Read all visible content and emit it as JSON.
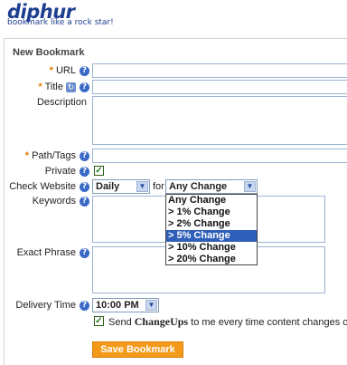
{
  "app": {
    "logo": "diphur",
    "tagline": "bookmark like a rock star!"
  },
  "form": {
    "heading": "New Bookmark",
    "required_mark": "*",
    "help_glyph": "?",
    "fields": {
      "url": "URL",
      "title": "Title",
      "description": "Description",
      "path_tags": "Path/Tags",
      "private": "Private",
      "check_website": "Check Website",
      "keywords": "Keywords",
      "exact_phrase": "Exact Phrase",
      "delivery_time": "Delivery Time"
    },
    "private_checked": true,
    "check_frequency": {
      "value": "Daily"
    },
    "for_label": "for",
    "change_select": {
      "value": "Any Change",
      "options": [
        "Any Change",
        "> 1% Change",
        "> 2% Change",
        "> 5% Change",
        "> 10% Change",
        "> 20% Change"
      ],
      "highlighted_index": 3
    },
    "delivery_time_value": "10:00 PM",
    "send_changeups": {
      "checked": true,
      "prefix": "Send ",
      "brand": "ChangeUps",
      "suffix": " to me every time content changes on th"
    },
    "save_button": "Save Bookmark"
  },
  "colors": {
    "brand": "#1d3f8f",
    "accent": "#f39a1b",
    "help": "#3a69c7",
    "highlight": "#2f5fb8"
  }
}
